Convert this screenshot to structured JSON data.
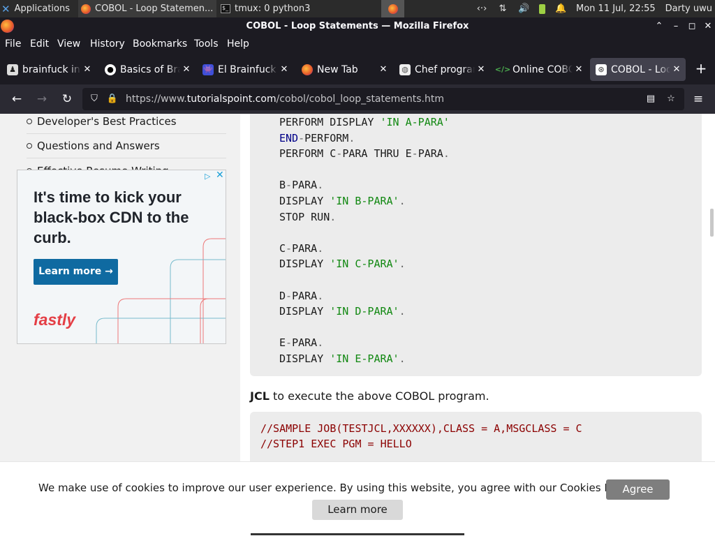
{
  "taskbar": {
    "applications_label": "Applications",
    "windows": [
      {
        "label": "COBOL - Loop Statemen..."
      },
      {
        "label": "tmux: 0 python3"
      }
    ],
    "clock": "Mon 11 Jul, 22:55",
    "user": "Darty uwu"
  },
  "window": {
    "title": "COBOL - Loop Statements — Mozilla Firefox"
  },
  "menu": {
    "items": [
      "File",
      "Edit",
      "View",
      "History",
      "Bookmarks",
      "Tools",
      "Help"
    ]
  },
  "tabs": [
    {
      "label": "brainfuck int",
      "icon": "brainfuck-favicon"
    },
    {
      "label": "Basics of Bra",
      "icon": "github-icon"
    },
    {
      "label": "El Brainfuck",
      "icon": "space-invader-icon"
    },
    {
      "label": "New Tab",
      "icon": "firefox-icon"
    },
    {
      "label": "Chef program",
      "icon": "chef-favicon"
    },
    {
      "label": "Online COBOL",
      "icon": "code-icon"
    },
    {
      "label": "COBOL - Loop",
      "icon": "tutorialspoint-icon",
      "active": true
    }
  ],
  "navbar": {
    "url_prefix": "https://www.",
    "url_host": "tutorialspoint.com",
    "url_path": "/cobol/cobol_loop_statements.htm"
  },
  "sidebar": {
    "items": [
      {
        "label": "Developer's Best Practices"
      },
      {
        "label": "Questions and Answers"
      },
      {
        "label": "Effective Resume Writing"
      }
    ]
  },
  "ad": {
    "headline": "It's time to kick your black-box CDN to the curb.",
    "cta": "Learn more →",
    "brand": "fastly"
  },
  "code_block_1": {
    "lines": [
      {
        "parts": [
          {
            "t": "PERFORM DISPLAY ",
            "c": ""
          },
          {
            "t": "'IN A-PARA'",
            "c": "str"
          }
        ]
      },
      {
        "parts": [
          {
            "t": "END",
            "c": "kw"
          },
          {
            "t": "-",
            "c": "pun"
          },
          {
            "t": "PERFORM",
            "c": ""
          },
          {
            "t": ".",
            "c": "pun"
          }
        ]
      },
      {
        "parts": [
          {
            "t": "PERFORM C",
            "c": ""
          },
          {
            "t": "-",
            "c": "pun"
          },
          {
            "t": "PARA THRU E",
            "c": ""
          },
          {
            "t": "-",
            "c": "pun"
          },
          {
            "t": "PARA",
            "c": ""
          },
          {
            "t": ".",
            "c": "pun"
          }
        ]
      },
      {
        "parts": []
      },
      {
        "parts": [
          {
            "t": "B",
            "c": ""
          },
          {
            "t": "-",
            "c": "pun"
          },
          {
            "t": "PARA",
            "c": ""
          },
          {
            "t": ".",
            "c": "pun"
          }
        ]
      },
      {
        "parts": [
          {
            "t": "DISPLAY ",
            "c": ""
          },
          {
            "t": "'IN B-PARA'",
            "c": "str"
          },
          {
            "t": ".",
            "c": "pun"
          }
        ]
      },
      {
        "parts": [
          {
            "t": "STOP RUN",
            "c": ""
          },
          {
            "t": ".",
            "c": "pun"
          }
        ]
      },
      {
        "parts": []
      },
      {
        "parts": [
          {
            "t": "C",
            "c": ""
          },
          {
            "t": "-",
            "c": "pun"
          },
          {
            "t": "PARA",
            "c": ""
          },
          {
            "t": ".",
            "c": "pun"
          }
        ]
      },
      {
        "parts": [
          {
            "t": "DISPLAY ",
            "c": ""
          },
          {
            "t": "'IN C-PARA'",
            "c": "str"
          },
          {
            "t": ".",
            "c": "pun"
          }
        ]
      },
      {
        "parts": []
      },
      {
        "parts": [
          {
            "t": "D",
            "c": ""
          },
          {
            "t": "-",
            "c": "pun"
          },
          {
            "t": "PARA",
            "c": ""
          },
          {
            "t": ".",
            "c": "pun"
          }
        ]
      },
      {
        "parts": [
          {
            "t": "DISPLAY ",
            "c": ""
          },
          {
            "t": "'IN D-PARA'",
            "c": "str"
          },
          {
            "t": ".",
            "c": "pun"
          }
        ]
      },
      {
        "parts": []
      },
      {
        "parts": [
          {
            "t": "E",
            "c": ""
          },
          {
            "t": "-",
            "c": "pun"
          },
          {
            "t": "PARA",
            "c": ""
          },
          {
            "t": ".",
            "c": "pun"
          }
        ]
      },
      {
        "parts": [
          {
            "t": "DISPLAY ",
            "c": ""
          },
          {
            "t": "'IN E-PARA'",
            "c": "str"
          },
          {
            "t": ".",
            "c": "pun"
          }
        ]
      }
    ]
  },
  "jcl_intro": {
    "bold": "JCL",
    "rest": " to execute the above COBOL program."
  },
  "code_block_2": {
    "lines": [
      "//SAMPLE JOB(TESTJCL,XXXXXX),CLASS = A,MSGCLASS = C",
      "//STEP1 EXEC PGM = HELLO"
    ]
  },
  "cookie": {
    "text": "We make use of cookies to improve our user experience. By using this website, you agree with our Cookies Policy.",
    "agree": "Agree",
    "learn_more": "Learn more"
  },
  "colors": {
    "string": "#118811",
    "keyword": "#000088",
    "jcl": "#8b0000",
    "accent": "#0f6aa1",
    "brand": "#e43e45"
  }
}
